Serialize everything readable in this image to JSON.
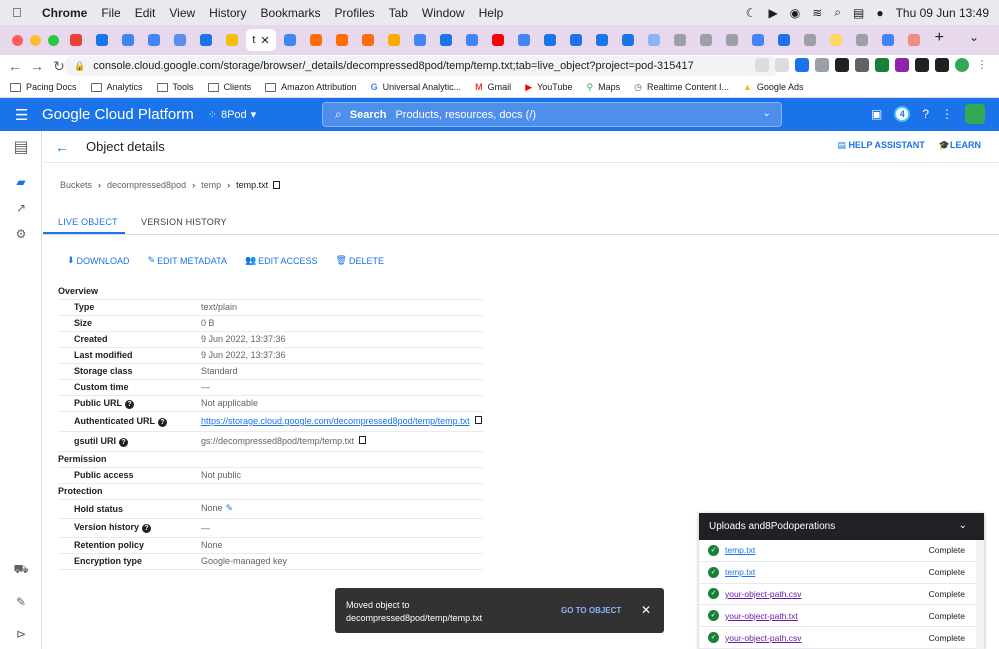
{
  "macos": {
    "app": "Chrome",
    "menus": [
      "File",
      "Edit",
      "View",
      "History",
      "Bookmarks",
      "Profiles",
      "Tab",
      "Window",
      "Help"
    ],
    "clock": "Thu 09 Jun  13:49"
  },
  "browser": {
    "active_tab_title": "t",
    "url": "console.cloud.google.com/storage/browser/_details/decompressed8pod/temp/temp.txt;tab=live_object?project=pod-315417",
    "bookmarks": [
      "Pacing Docs",
      "Analytics",
      "Tools",
      "Clients",
      "Amazon Attribution",
      "Universal Analytic...",
      "Gmail",
      "YouTube",
      "Maps",
      "Realtime Content I...",
      "Google Ads"
    ]
  },
  "header": {
    "title": "Google Cloud Platform",
    "project": "8Pod",
    "search_label": "Search",
    "search_placeholder": "Products, resources, docs (/)",
    "notif_count": "4"
  },
  "page": {
    "title": "Object details",
    "help_assistant": "HELP ASSISTANT",
    "learn": "LEARN"
  },
  "breadcrumb": [
    "Buckets",
    "decompressed8pod",
    "temp",
    "temp.txt"
  ],
  "tabs": [
    "LIVE OBJECT",
    "VERSION HISTORY"
  ],
  "actions": [
    "DOWNLOAD",
    "EDIT METADATA",
    "EDIT ACCESS",
    "DELETE"
  ],
  "details": {
    "overview": "Overview",
    "type_k": "Type",
    "type_v": "text/plain",
    "size_k": "Size",
    "size_v": "0 B",
    "created_k": "Created",
    "created_v": "9 Jun 2022, 13:37:36",
    "modified_k": "Last modified",
    "modified_v": "9 Jun 2022, 13:37:36",
    "storage_k": "Storage class",
    "storage_v": "Standard",
    "custom_k": "Custom time",
    "custom_v": "—",
    "public_k": "Public URL",
    "public_v": "Not applicable",
    "auth_k": "Authenticated URL",
    "auth_v": "https://storage.cloud.google.com/decompressed8pod/temp/temp.txt",
    "gsutil_k": "gsutil URI",
    "gsutil_v": "gs://decompressed8pod/temp/temp.txt",
    "permission": "Permission",
    "access_k": "Public access",
    "access_v": "Not public",
    "protection": "Protection",
    "hold_k": "Hold status",
    "hold_v": "None",
    "version_k": "Version history",
    "version_v": "—",
    "retention_k": "Retention policy",
    "retention_v": "None",
    "encryption_k": "Encryption type",
    "encryption_v": "Google-managed key"
  },
  "toast": {
    "line1": "Moved object to",
    "line2": "decompressed8pod/temp/temp.txt",
    "action": "GO TO OBJECT"
  },
  "uploads": {
    "title": "Uploads and8Podoperations",
    "rows": [
      {
        "file": "temp.txt",
        "status": "Complete"
      },
      {
        "file": "temp.txt",
        "status": "Complete"
      },
      {
        "file": "your-object-path.csv",
        "status": "Complete"
      },
      {
        "file": "your-object-path.txt",
        "status": "Complete"
      },
      {
        "file": "your-object-path.csv",
        "status": "Complete"
      }
    ]
  }
}
